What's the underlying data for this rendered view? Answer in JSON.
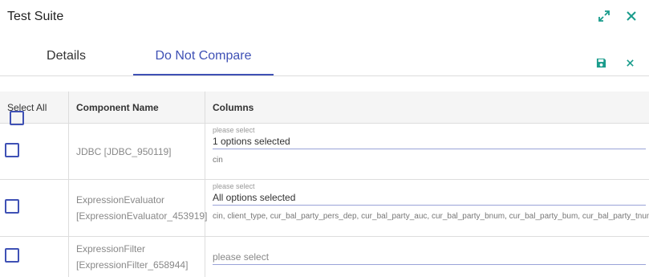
{
  "dialog": {
    "title": "Test Suite"
  },
  "tabs": [
    {
      "label": "Details"
    },
    {
      "label": "Do Not Compare"
    }
  ],
  "table": {
    "select_all_label": "Select All",
    "headers": {
      "component": "Component Name",
      "columns": "Columns"
    },
    "rows": [
      {
        "component": "JDBC [JDBC_950119]",
        "placeholder": "please select",
        "selection": "1 options selected",
        "columns": "cin"
      },
      {
        "component_line1": "ExpressionEvaluator",
        "component_line2": "[ExpressionEvaluator_453919]",
        "placeholder": "please select",
        "selection": "All options selected",
        "columns": "cin, client_type, cur_bal_party_pers_dep, cur_bal_party_auc, cur_bal_party_bnum, cur_bal_party_bum, cur_bal_party_tnum"
      },
      {
        "component_line1": "ExpressionFilter",
        "component_line2": "[ExpressionFilter_658944]",
        "selection": "please select"
      }
    ]
  },
  "icons": {
    "expand": "expand-icon",
    "close": "close-icon",
    "save": "save-icon",
    "cancel": "cancel-icon"
  },
  "colors": {
    "accent": "#3f51b5",
    "icon_teal": "#1a9c8c"
  }
}
